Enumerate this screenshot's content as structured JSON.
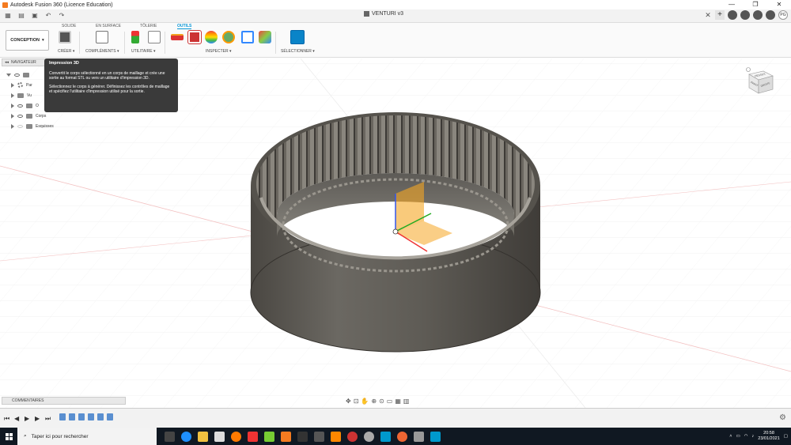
{
  "window": {
    "title": "Autodesk Fusion 360 (Licence Education)",
    "minimize": "—",
    "maximize": "❐",
    "close": "✕"
  },
  "document": {
    "title": "VENTURI v3"
  },
  "qat": {
    "user_initials": "PG"
  },
  "ribbon": {
    "tabs": [
      "SOLIDE",
      "EN SURFACE",
      "TÔLERIE",
      "OUTILS"
    ],
    "active_tab": "OUTILS",
    "workspace": "CONCEPTION",
    "groups": {
      "creer": "CRÉER ▾",
      "complements": "COMPLÉMENTS ▾",
      "utilitaire": "UTILITAIRE ▾",
      "inspecter": "INSPECTER ▾",
      "selectionner": "SÉLECTIONNER ▾"
    }
  },
  "navigator": {
    "title": "NAVIGATEUR",
    "items": [
      {
        "label": ""
      },
      {
        "label": "Par"
      },
      {
        "label": "Vu"
      },
      {
        "label": "O"
      },
      {
        "label": "Corps"
      },
      {
        "label": "Esquisses"
      }
    ]
  },
  "tooltip": {
    "title": "Impression 3D",
    "p1": "Convertit le corps sélectionné en un corps de maillage et crée une sortie au format STL ou vers un utilitaire d'impression 3D.",
    "p2": "Sélectionnez le corps à générer. Définissez les contrôles de maillage et spécifiez l'utilitaire d'impression utilisé pour la sortie."
  },
  "viewcube": {
    "front": "DESSUS",
    "right": "DROITE",
    "left": "AVANT"
  },
  "comments": {
    "label": "COMMENTAIRES"
  },
  "taskbar": {
    "search_placeholder": "Taper ici pour rechercher",
    "time": "20:58",
    "date": "23/01/2021"
  },
  "colors": {
    "accent": "#0696d7",
    "ring_body": "#5d5a55",
    "taskbar": "#101822"
  }
}
